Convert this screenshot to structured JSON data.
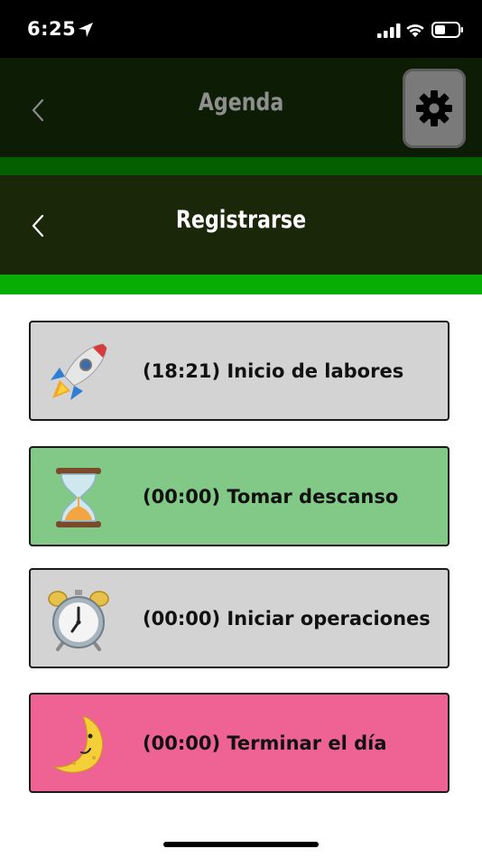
{
  "status_bar": {
    "time": "6:25",
    "icons": [
      "location-arrow-icon",
      "cellular-signal-icon",
      "wifi-icon",
      "battery-icon"
    ]
  },
  "nav_top": {
    "title": "Agenda",
    "back_icon": "chevron-left-icon",
    "settings_icon": "gear-icon"
  },
  "nav_sub": {
    "title": "Registrarse",
    "back_icon": "chevron-left-icon"
  },
  "actions": [
    {
      "icon": "rocket-icon",
      "label": "(18:21) Inicio de labores",
      "color": "#d3d3d3"
    },
    {
      "icon": "hourglass-icon",
      "label": "(00:00) Tomar descanso",
      "color": "#82c886"
    },
    {
      "icon": "alarm-clock-icon",
      "label": "(00:00) Iniciar operaciones",
      "color": "#d3d3d3"
    },
    {
      "icon": "crescent-moon-face-icon",
      "label": "(00:00) Terminar el día",
      "color": "#ef6394"
    }
  ],
  "colors": {
    "nav_top_bg": "#0d1d05",
    "nav_sub_bg": "#1a2809",
    "stripe_dark": "#045f00",
    "stripe_bright": "#07ad03"
  }
}
